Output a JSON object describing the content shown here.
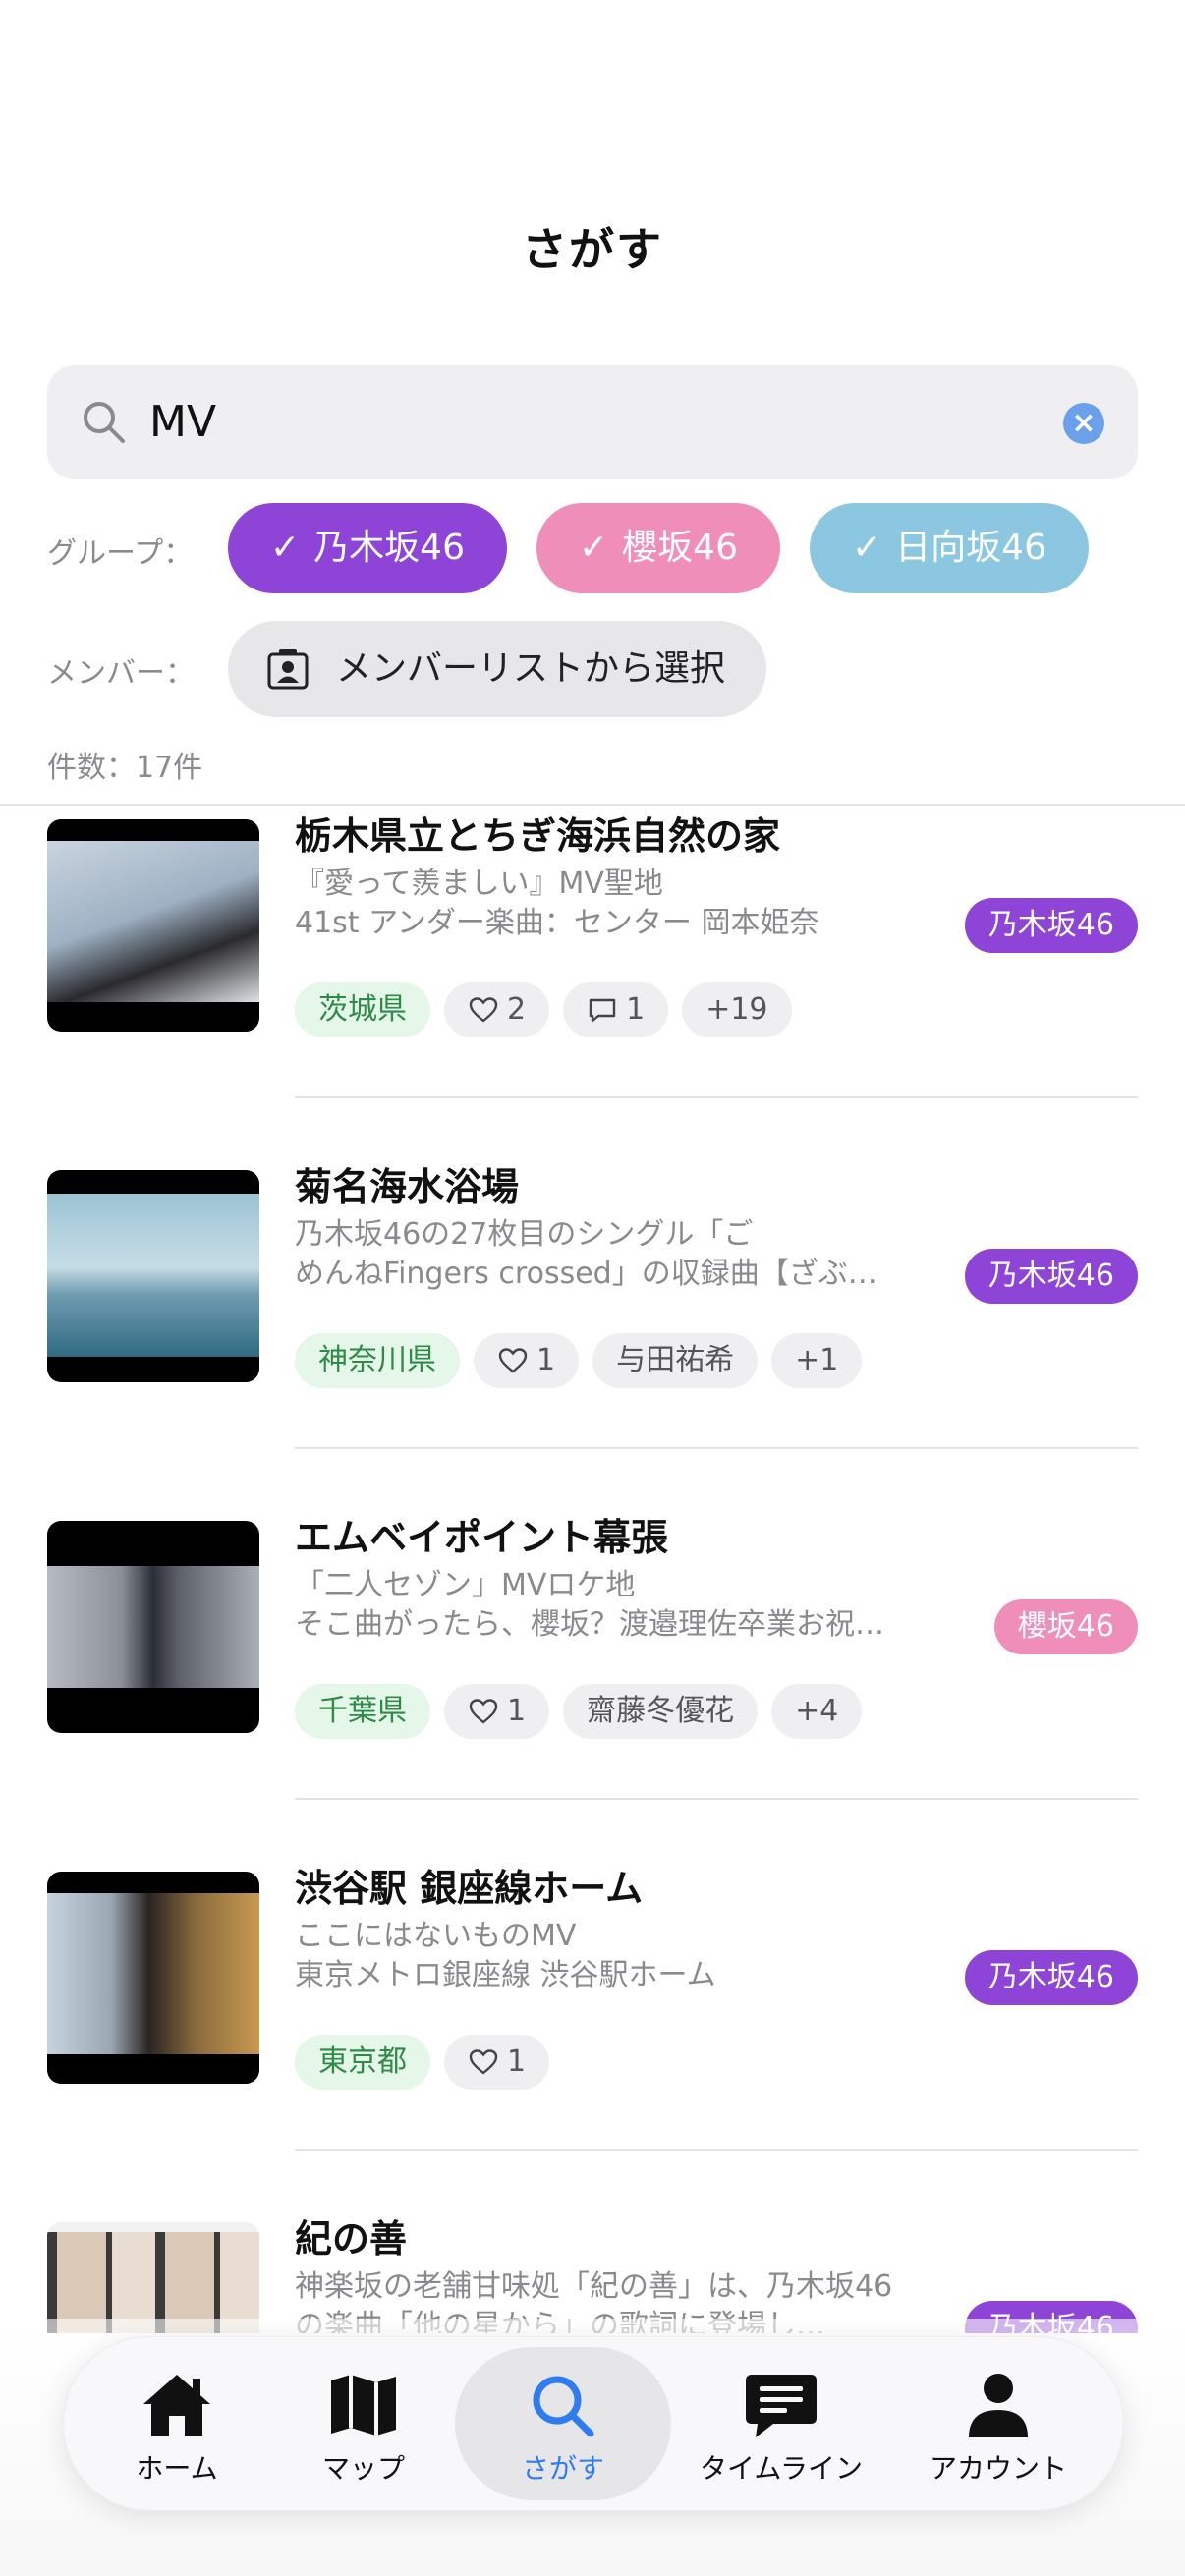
{
  "header": {
    "title": "さがす"
  },
  "search": {
    "value": "MV"
  },
  "filters": {
    "group_label": "グループ：",
    "groups": [
      {
        "label": "乃木坂46",
        "color": "#8e44d6"
      },
      {
        "label": "櫻坂46",
        "color": "#ef8fb9"
      },
      {
        "label": "日向坂46",
        "color": "#8cc7e1"
      }
    ],
    "member_label": "メンバー：",
    "member_button": "メンバーリストから選択"
  },
  "result_count": "件数：17件",
  "results": [
    {
      "name": "栃木県立とちぎ海浜自然の家",
      "desc1": "『愛って羨ましい』MV聖地",
      "desc2": "41st アンダー楽曲：センター 岡本姫奈",
      "group": "乃木坂46",
      "group_color": "#8e44d6",
      "prefecture": "茨城県",
      "likes": "2",
      "comments": "1",
      "extra": "+19"
    },
    {
      "name": "菊名海水浴場",
      "desc1": "乃木坂46の27枚目のシングル「ご",
      "desc2": "めんねFingers crossed」の収録曲【ざぶ…",
      "group": "乃木坂46",
      "group_color": "#8e44d6",
      "prefecture": "神奈川県",
      "likes": "1",
      "member": "与田祐希",
      "extra": "+1"
    },
    {
      "name": "エムベイポイント幕張",
      "desc1": "「二人セゾン」MVロケ地",
      "desc2": "そこ曲がったら、櫻坂？渡邉理佐卒業お祝い…",
      "group": "櫻坂46",
      "group_color": "#ef8fb9",
      "prefecture": "千葉県",
      "likes": "1",
      "member": "齋藤冬優花",
      "extra": "+4"
    },
    {
      "name": "渋谷駅 銀座線ホーム",
      "desc1": "ここにはないものMV",
      "desc2": "東京メトロ銀座線 渋谷駅ホーム",
      "group": "乃木坂46",
      "group_color": "#8e44d6",
      "prefecture": "東京都",
      "likes": "1"
    },
    {
      "name": "紀の善",
      "desc1": "神楽坂の老舗甘味処「紀の善」は、乃木坂46",
      "desc2": "の楽曲「他の星から」の歌詞に登場し…",
      "group": "乃木坂46",
      "group_color": "#8e44d6"
    }
  ],
  "nav": {
    "items": [
      {
        "label": "ホーム",
        "icon": "home-icon"
      },
      {
        "label": "マップ",
        "icon": "map-icon"
      },
      {
        "label": "さがす",
        "icon": "search-icon"
      },
      {
        "label": "タイムライン",
        "icon": "chat-icon"
      },
      {
        "label": "アカウント",
        "icon": "person-icon"
      }
    ],
    "active_index": 2,
    "active_color": "#2e7cf0"
  }
}
